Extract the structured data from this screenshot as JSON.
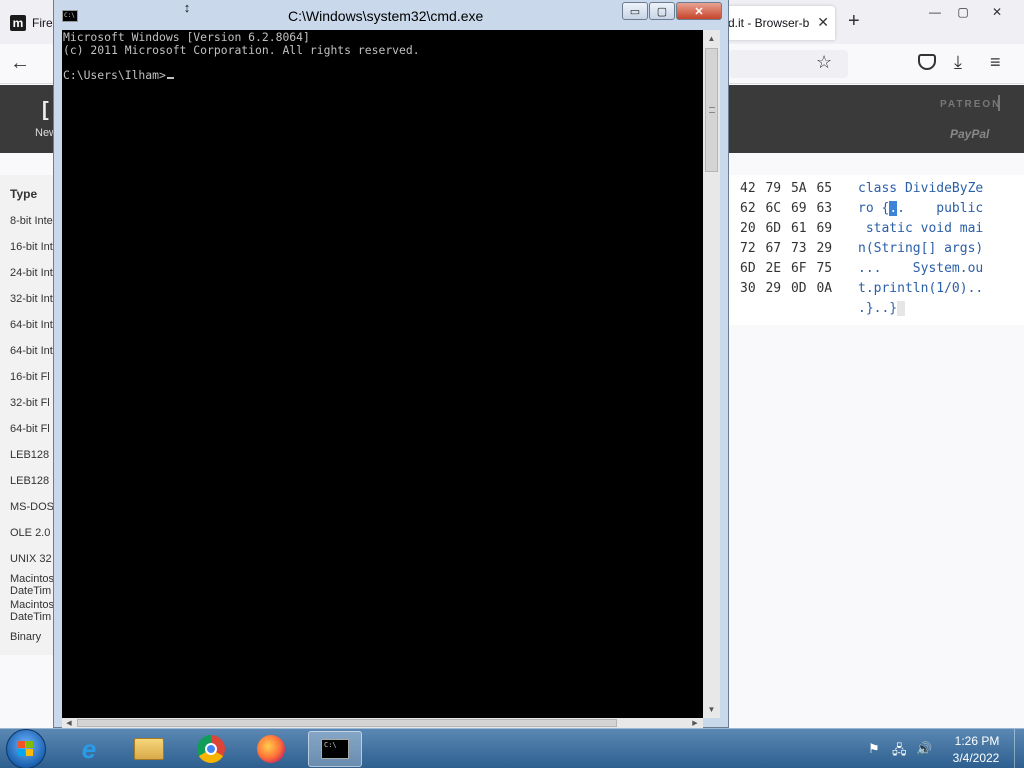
{
  "browser": {
    "tabs": [
      {
        "label": "Fire",
        "favicon": "m"
      },
      {
        "label": "d.it - Browser-b",
        "close": "✕"
      }
    ],
    "new_tab": "+",
    "window_controls": {
      "minimize": "—",
      "maximize": "▢",
      "close": "✕"
    },
    "nav": {
      "back": "←",
      "star": "☆",
      "download": "⤓",
      "menu": "≡"
    },
    "header": {
      "logo": "[",
      "new_label": "New",
      "patreon": "PATREON",
      "paypal": "PayPal"
    },
    "sidebar": {
      "type_label": "Type",
      "items": [
        "8-bit Inte",
        "16-bit Int",
        "24-bit Int",
        "32-bit Int",
        "64-bit Int",
        "64-bit Int",
        "16-bit Fl",
        "32-bit Fl",
        "64-bit Fl",
        "LEB128",
        "LEB128",
        "MS-DOS",
        "OLE 2.0",
        "UNIX 32",
        "Macintos\nDateTim",
        "Macintos\nDateTim",
        "Binary"
      ]
    },
    "hex": {
      "rows": [
        "42 79 5A 65",
        "62 6C 69 63",
        "20 6D 61 69",
        "72 67 73 29",
        "6D 2E 6F 75",
        "30 29 0D 0A"
      ],
      "text_rows": [
        [
          "class DivideByZe",
          "",
          ""
        ],
        [
          "ro {",
          ".",
          ".    public"
        ],
        [
          " static void mai",
          "",
          ""
        ],
        [
          "n(String[] args)",
          "",
          ""
        ],
        [
          "...    System.ou",
          "",
          ""
        ],
        [
          "t.println(1/0)..",
          "",
          ""
        ],
        [
          ".}..}",
          "",
          ""
        ]
      ]
    }
  },
  "cmd": {
    "title": "C:\\Windows\\system32\\cmd.exe",
    "controls": {
      "minimize": "▭",
      "maximize": "▢",
      "close": "✕"
    },
    "lines": [
      "Microsoft Windows [Version 6.2.8064]",
      "(c) 2011 Microsoft Corporation. All rights reserved.",
      "",
      "C:\\Users\\Ilham>"
    ],
    "icon_text": "C:\\"
  },
  "taskbar": {
    "clock_time": "1:26 PM",
    "clock_date": "3/4/2022",
    "tray": [
      "⚑",
      "🖧",
      "🔊"
    ],
    "ie_glyph": "e"
  },
  "colors": {
    "console_bg": "#000000",
    "console_fg": "#c0c0c0",
    "hex_text": "#2b5fa8",
    "selection": "#3d84d6",
    "taskbar": "#2d5f8f"
  }
}
